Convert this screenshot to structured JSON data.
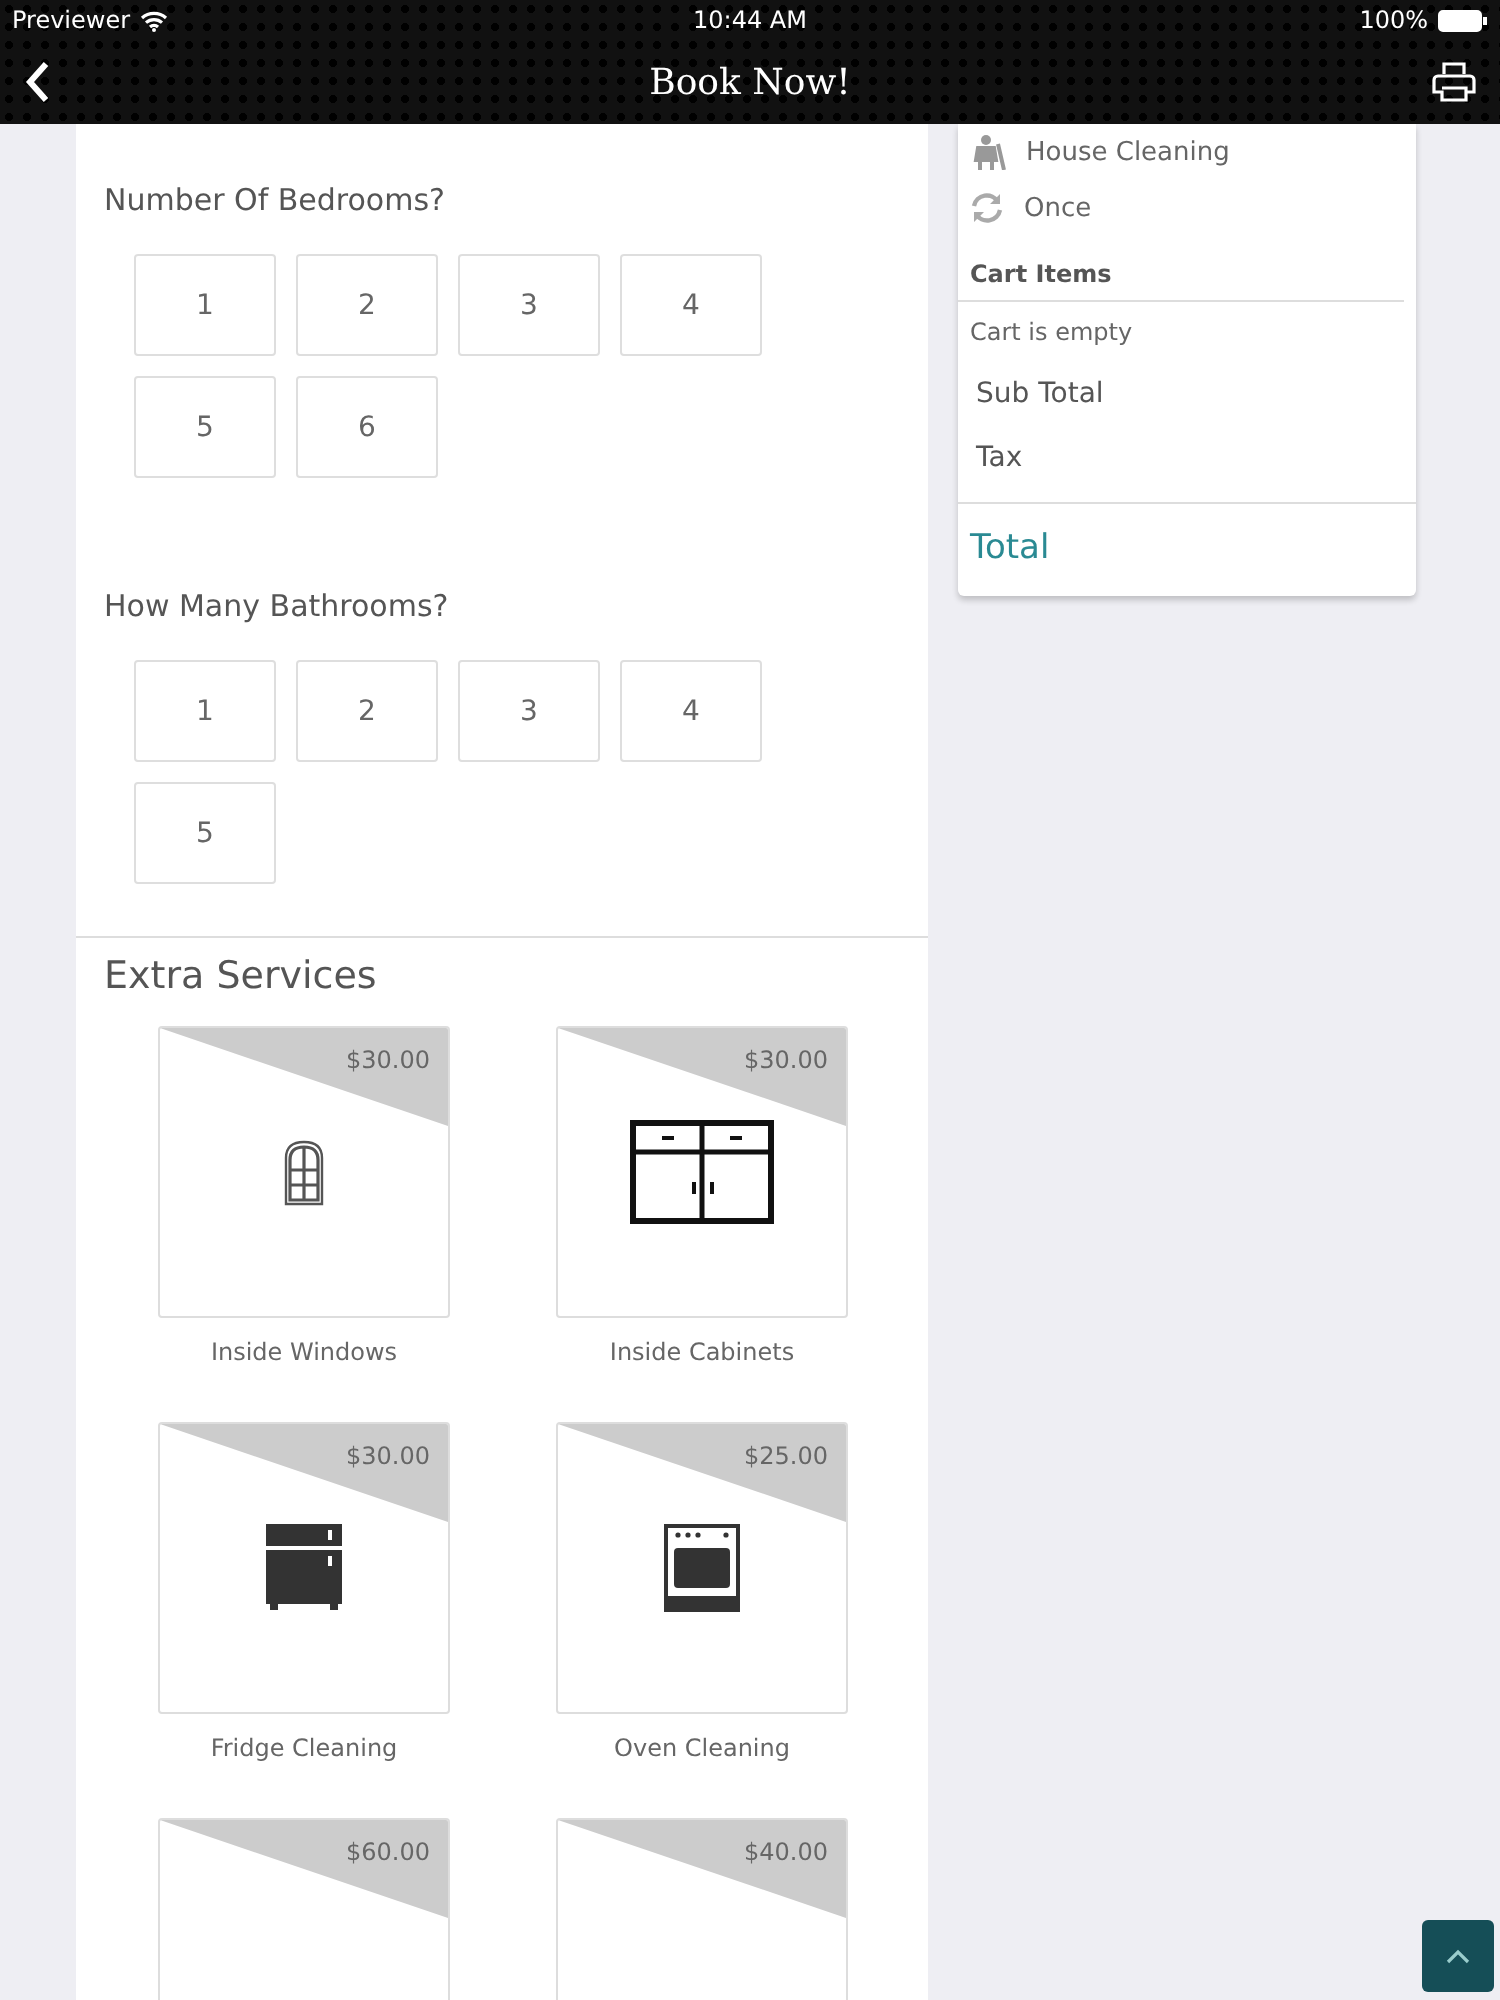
{
  "status_bar": {
    "carrier": "Previewer",
    "time": "10:44 AM",
    "battery": "100%"
  },
  "nav_bar": {
    "title": "Book Now!"
  },
  "questions": [
    {
      "label": "Number Of Bedrooms?",
      "options": [
        {
          "label": "1",
          "selected": false
        },
        {
          "label": "2",
          "selected": false
        },
        {
          "label": "3",
          "selected": false
        },
        {
          "label": "4",
          "selected": false
        },
        {
          "label": "5",
          "selected": false
        },
        {
          "label": "6",
          "selected": false
        }
      ]
    },
    {
      "label": "How Many Bathrooms?",
      "options": [
        {
          "label": "1",
          "selected": false
        },
        {
          "label": "2",
          "selected": false
        },
        {
          "label": "3",
          "selected": false
        },
        {
          "label": "4",
          "selected": false
        },
        {
          "label": "5",
          "selected": false
        }
      ]
    }
  ],
  "extra_services": {
    "title": "Extra Services",
    "items": [
      {
        "kind": "window",
        "price": "$30.00",
        "name": "Inside Windows"
      },
      {
        "kind": "cabinet",
        "price": "$30.00",
        "name": "Inside Cabinets"
      },
      {
        "kind": "fridge",
        "price": "$30.00",
        "name": "Fridge Cleaning"
      },
      {
        "kind": "oven",
        "price": "$25.00",
        "name": "Oven Cleaning"
      },
      {
        "kind": "hidden",
        "price": "$60.00"
      },
      {
        "kind": "hidden",
        "price": "$40.00"
      }
    ]
  },
  "summary": {
    "service": "House Cleaning",
    "frequency": "Once",
    "cart_heading": "Cart Items",
    "cart_message": "Cart is empty",
    "sub_total_label": "Sub Total",
    "tax_label": "Tax",
    "total_label": "Total"
  }
}
